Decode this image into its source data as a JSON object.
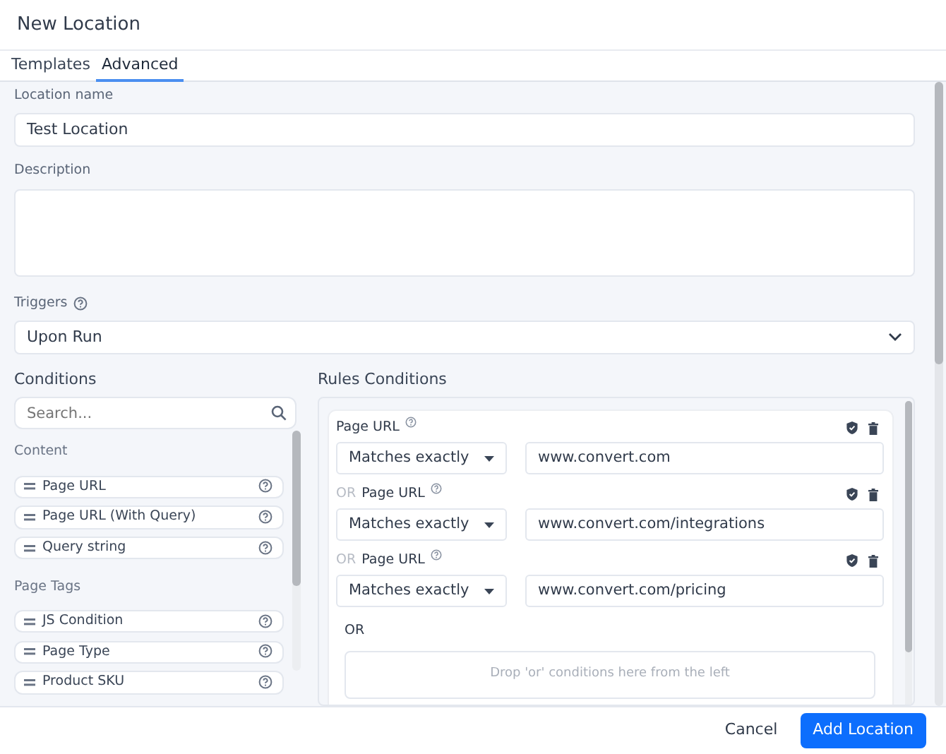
{
  "window": {
    "title": "New Location"
  },
  "tabs": [
    {
      "label": "Templates",
      "selected": false
    },
    {
      "label": "Advanced",
      "selected": true
    }
  ],
  "location_name": {
    "label": "Location name",
    "value": "Test Location"
  },
  "description": {
    "label": "Description"
  },
  "triggers": {
    "label": "Triggers",
    "value": "Upon Run"
  },
  "conditions": {
    "title": "Conditions",
    "search": {
      "placeholder": "Search..."
    },
    "groups": [
      {
        "title": "Content",
        "items": [
          "Page URL",
          "Page URL (With Query)",
          "Query string"
        ]
      },
      {
        "title": "Page Tags",
        "items": [
          "JS Condition",
          "Page Type",
          "Product SKU"
        ]
      }
    ]
  },
  "rules_conditions": {
    "title": "Rules Conditions",
    "rules": [
      {
        "label": "Page URL",
        "operator": "Matches exactly",
        "value": "www.convert.com"
      },
      {
        "connector": "OR",
        "label": "Page URL",
        "operator": "Matches exactly",
        "value": "www.convert.com/integrations"
      },
      {
        "connector": "OR",
        "label": "Page URL",
        "operator": "Matches exactly",
        "value": "www.convert.com/pricing"
      }
    ],
    "or_label": "OR",
    "drop_hint": "Drop 'or' conditions here from the left"
  },
  "buttons": {
    "cancel": "Cancel",
    "submit": "Add Location"
  }
}
